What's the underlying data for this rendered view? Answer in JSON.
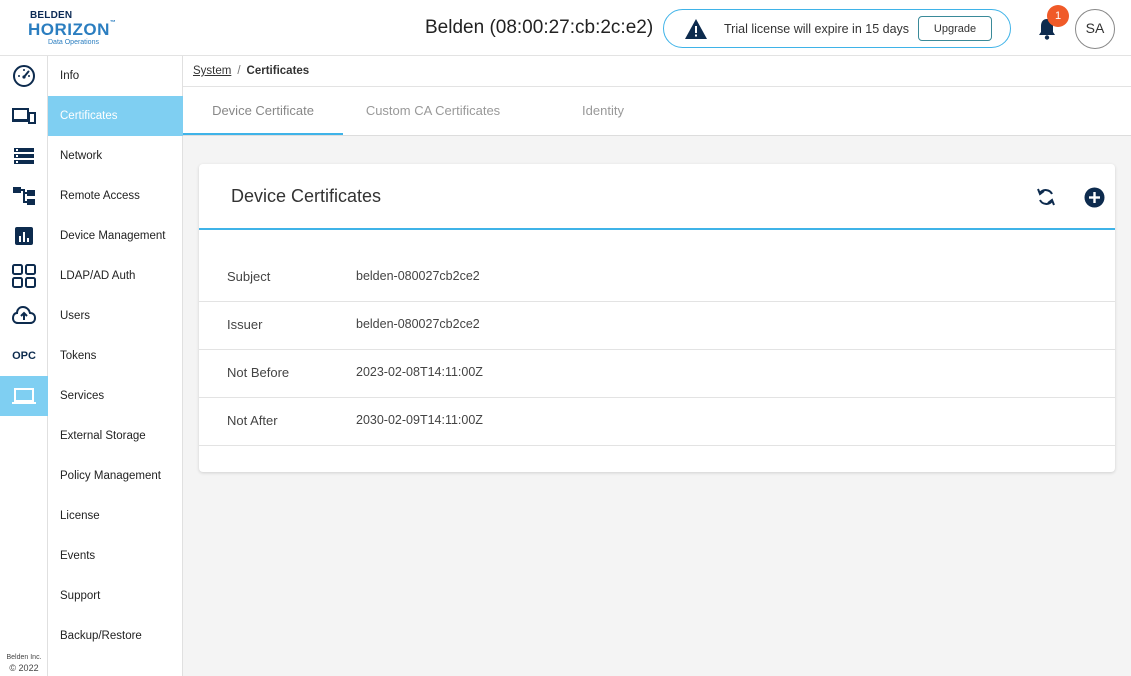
{
  "header": {
    "logo": {
      "line1": "BELDEN",
      "line2": "HORIZON",
      "tm": "™",
      "line3": "Data Operations"
    },
    "device_title": "Belden (08:00:27:cb:2c:e2)",
    "license_message": "Trial license will expire in 15 days",
    "upgrade_label": "Upgrade",
    "notification_count": "1",
    "avatar_initials": "SA"
  },
  "rail": {
    "items": [
      {
        "icon": "dashboard-gauge-icon"
      },
      {
        "icon": "devices-icon"
      },
      {
        "icon": "list-server-icon"
      },
      {
        "icon": "hierarchy-tree-icon"
      },
      {
        "icon": "bar-chart-icon"
      },
      {
        "icon": "apps-grid-icon"
      },
      {
        "icon": "cloud-upload-icon"
      },
      {
        "icon": "opc-text-icon",
        "label": "OPC"
      },
      {
        "icon": "laptop-system-icon",
        "active": true
      }
    ],
    "copyright_line1": "Belden Inc.",
    "copyright_line2": "© 2022"
  },
  "subnav": {
    "items": [
      {
        "label": "Info"
      },
      {
        "label": "Certificates",
        "active": true
      },
      {
        "label": "Network"
      },
      {
        "label": "Remote Access"
      },
      {
        "label": "Device Management"
      },
      {
        "label": "LDAP/AD Auth"
      },
      {
        "label": "Users"
      },
      {
        "label": "Tokens"
      },
      {
        "label": "Services"
      },
      {
        "label": "External Storage"
      },
      {
        "label": "Policy Management"
      },
      {
        "label": "License"
      },
      {
        "label": "Events"
      },
      {
        "label": "Support"
      },
      {
        "label": "Backup/Restore"
      }
    ]
  },
  "breadcrumb": {
    "parent": "System",
    "separator": "/",
    "current": "Certificates"
  },
  "tabs": [
    {
      "label": "Device Certificate",
      "active": true
    },
    {
      "label": "Custom CA Certificates"
    },
    {
      "label": "Identity"
    }
  ],
  "card": {
    "title": "Device Certificates",
    "rows": [
      {
        "key": "Subject",
        "value": "belden-080027cb2ce2"
      },
      {
        "key": "Issuer",
        "value": "belden-080027cb2ce2"
      },
      {
        "key": "Not Before",
        "value": "2023-02-08T14:11:00Z"
      },
      {
        "key": "Not After",
        "value": "2030-02-09T14:11:00Z"
      }
    ]
  },
  "colors": {
    "accent": "#3fb3e8",
    "active_nav": "#7fcff2",
    "badge": "#f05a28",
    "dark_icon": "#0d2b4e"
  }
}
